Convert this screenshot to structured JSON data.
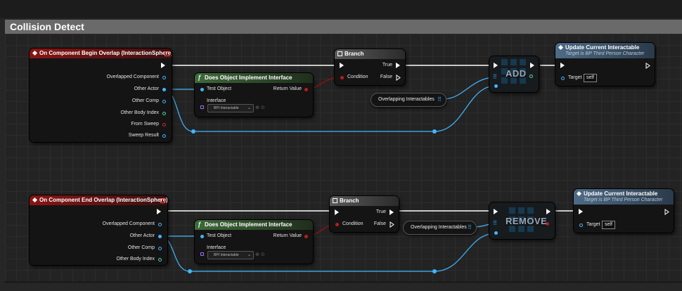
{
  "comment": {
    "title": "Collision Detect"
  },
  "colors": {
    "exec": "#ffffff",
    "object": "#3fb8ff",
    "bool": "#c21a1a",
    "int": "#5ecfa0",
    "event_header": "#8a1414",
    "func_header": "#3f6a3a"
  },
  "row1": {
    "event": {
      "title": "On Component Begin Overlap (InteractionSphere)",
      "pins": [
        "Overlapped Component",
        "Other Actor",
        "Other Comp",
        "Other Body Index",
        "From Sweep",
        "Sweep Result"
      ]
    },
    "impl": {
      "title": "Does Object Implement Interface",
      "test_object": "Test Object",
      "return_value": "Return Value",
      "interface_label": "Interface",
      "interface_value": "BPI Interactable"
    },
    "branch": {
      "title": "Branch",
      "true_label": "True",
      "false_label": "False",
      "condition": "Condition"
    },
    "var": {
      "label": "Overlapping Interactables"
    },
    "op": {
      "label": "ADD"
    },
    "update": {
      "title": "Update Current Interactable",
      "subtitle": "Target is BP Third Person Character",
      "target_label": "Target",
      "target_value": "self"
    }
  },
  "row2": {
    "event": {
      "title": "On Component End Overlap (InteractionSphere)",
      "pins": [
        "Overlapped Component",
        "Other Actor",
        "Other Comp",
        "Other Body Index"
      ]
    },
    "impl": {
      "title": "Does Object Implement Interface",
      "test_object": "Test Object",
      "return_value": "Return Value",
      "interface_label": "Interface",
      "interface_value": "BPI Interactable"
    },
    "branch": {
      "title": "Branch",
      "true_label": "True",
      "false_label": "False",
      "condition": "Condition"
    },
    "var": {
      "label": "Overlapping Interactables"
    },
    "op": {
      "label": "REMOVE"
    },
    "update": {
      "title": "Update Current Interactable",
      "subtitle": "Target is BP Third Person Character",
      "target_label": "Target",
      "target_value": "self"
    }
  }
}
